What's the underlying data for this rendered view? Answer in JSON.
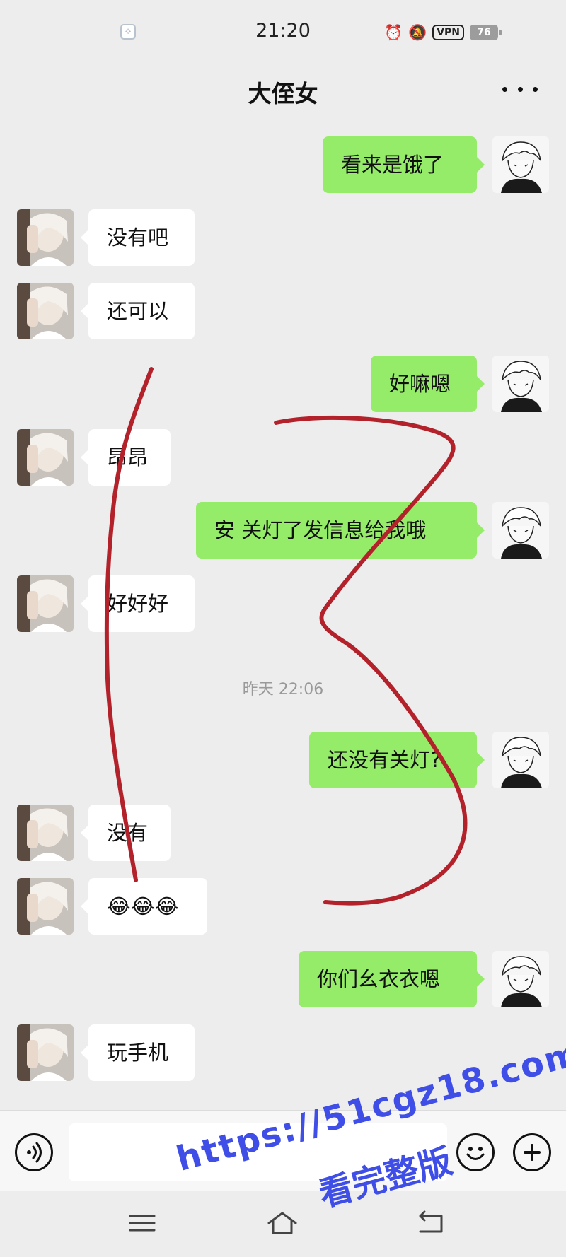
{
  "status_bar": {
    "time": "21:20",
    "left_icon": "vpn-key-icon",
    "icons": [
      "alarm-icon",
      "mute-bell-icon"
    ],
    "vpn_label": "VPN",
    "battery": "76"
  },
  "header": {
    "title": "大侄女",
    "more_icon": "more-dots-icon"
  },
  "messages": [
    {
      "side": "out",
      "text": "看来是饿了"
    },
    {
      "side": "in",
      "text": "没有吧"
    },
    {
      "side": "in",
      "text": "还可以"
    },
    {
      "side": "out",
      "text": "好嘛嗯"
    },
    {
      "side": "in",
      "text": "昂昂"
    },
    {
      "side": "out",
      "text": "安 关灯了发信息给我哦"
    },
    {
      "side": "in",
      "text": "好好好"
    },
    {
      "side": "out",
      "text": "还没有关灯?"
    },
    {
      "side": "in",
      "text": "没有"
    },
    {
      "side": "in",
      "text": "😂😂😂"
    },
    {
      "side": "out",
      "text": "你们幺衣衣嗯"
    },
    {
      "side": "in",
      "text": "玩手机"
    }
  ],
  "timestamp": "昨天 22:06",
  "input_bar": {
    "voice_icon": "voice-icon",
    "input_value": "",
    "emoji_icon": "emoji-icon",
    "plus_icon": "plus-icon"
  },
  "nav_bar": {
    "icons": [
      "menu-icon",
      "home-icon",
      "back-icon"
    ]
  },
  "watermark": {
    "line1": "https://51cgz18.com",
    "line2": "看完整版",
    "color": "#3e4ee6"
  },
  "colors": {
    "background": "#ededed",
    "outgoing_bubble": "#95ec69",
    "incoming_bubble": "#ffffff",
    "annotation_stroke": "#b3222b"
  }
}
